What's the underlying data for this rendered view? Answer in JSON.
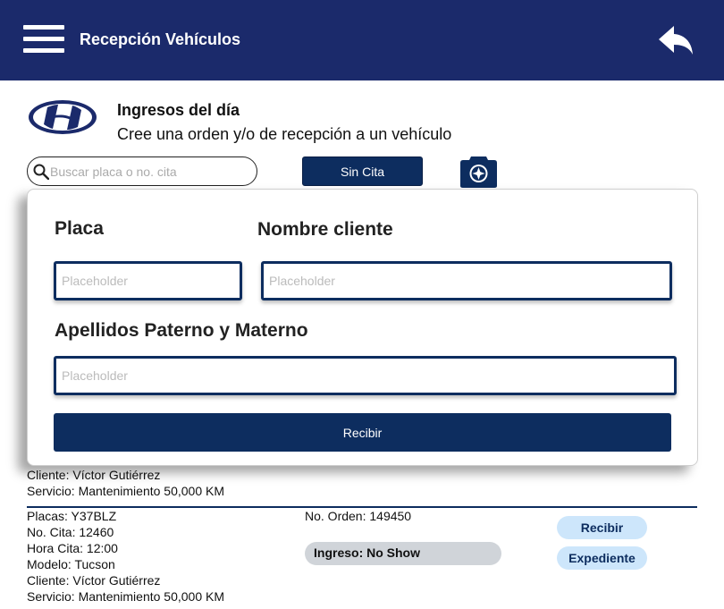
{
  "header": {
    "title": "Recepción Vehículos",
    "menu_icon": "hamburger-menu-icon",
    "back_icon": "reply-arrow-icon",
    "background_color": "#1b2a6b"
  },
  "brand": {
    "logo": "hyundai-logo"
  },
  "intro": {
    "title": "Ingresos del día",
    "subtitle": "Cree una orden y/o de recepción a un vehículo"
  },
  "search": {
    "placeholder": "Buscar placa o no. cita",
    "icon": "search-icon"
  },
  "actions": {
    "sin_cita_label": "Sin Cita",
    "camera_icon": "camera-icon"
  },
  "modal": {
    "placa_label": "Placa",
    "nombre_label": "Nombre cliente",
    "apellidos_label": "Apellidos Paterno y Materno",
    "placa_placeholder": "Placeholder",
    "nombre_placeholder": "Placeholder",
    "apellidos_placeholder": "Placeholder",
    "submit_label": "Recibir"
  },
  "records": [
    {
      "cliente": "Cliente: Víctor Gutiérrez",
      "servicio": "Servicio: Mantenimiento 50,000 KM"
    },
    {
      "placas": "Placas: Y37BLZ",
      "cita": "No. Cita: 12460",
      "hora": "Hora Cita: 12:00",
      "modelo": "Modelo: Tucson",
      "cliente": "Cliente: Víctor Gutiérrez",
      "servicio": "Servicio: Mantenimiento 50,000 KM",
      "orden": "No. Orden: 149450",
      "ingreso": "Ingreso: No Show",
      "recibir_label": "Recibir",
      "expediente_label": "Expediente"
    }
  ],
  "colors": {
    "primary": "#0d2d5f",
    "pill_button": "#cde6fb",
    "status_pill": "#d0d4d9"
  }
}
